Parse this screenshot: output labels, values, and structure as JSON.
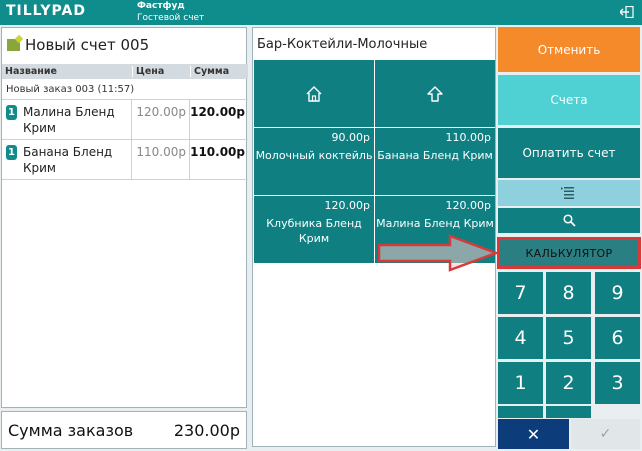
{
  "header": {
    "logo": "TILLYPAD",
    "title": "Фастфуд",
    "subtitle": "Гостевой счет",
    "exit_icon": "exit-icon"
  },
  "order": {
    "title": "Новый счет 005",
    "columns": {
      "name": "Название",
      "price": "Цена",
      "sum": "Сумма"
    },
    "group": "Новый заказ 003 (11:57)",
    "items": [
      {
        "qty": "1",
        "name": "Малина Бленд Крим",
        "price": "120.00р",
        "sum": "120.00р"
      },
      {
        "qty": "1",
        "name": "Банана Бленд Крим",
        "price": "110.00р",
        "sum": "110.00р"
      }
    ],
    "total_label": "Сумма заказов",
    "total_value": "230.00р"
  },
  "menu": {
    "title": "Бар-Коктейли-Молочные",
    "nav_icons": [
      "home-icon",
      "up-icon"
    ],
    "tiles": [
      {
        "price": "90.00р",
        "name": "Молочный коктейль"
      },
      {
        "price": "110.00р",
        "name": "Банана Бленд Крим"
      },
      {
        "price": "120.00р",
        "name": "Клубника Бленд Крим"
      },
      {
        "price": "120.00р",
        "name": "Малина Бленд Крим"
      }
    ]
  },
  "actions": {
    "cancel": "Отменить",
    "bills": "Счета",
    "pay": "Оплатить счет",
    "calculator": "КАЛЬКУЛЯТОР",
    "confirm_x": "✕",
    "confirm_ok": "✓"
  },
  "keypad": [
    "7",
    "8",
    "9",
    "4",
    "5",
    "6",
    "1",
    "2",
    "3"
  ],
  "colors": {
    "teal": "#0f7f82",
    "orange": "#f58a2b",
    "light_teal": "#4fd0d3",
    "annotation_red": "#d83a3a"
  }
}
